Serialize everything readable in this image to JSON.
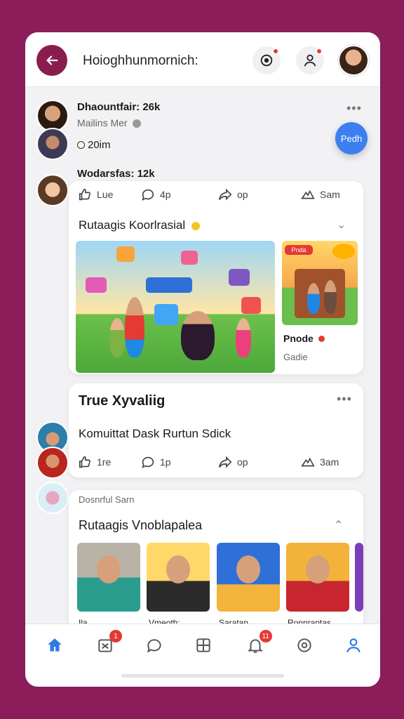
{
  "header": {
    "title": "Hoioghhunmornich:"
  },
  "fab": {
    "label": "Pedh"
  },
  "post1": {
    "author": "Dhaountfair: 26k",
    "sub": "Mailins Mer",
    "stat": "20im",
    "second_line": "Wodarsfas: 12k"
  },
  "card1": {
    "reactions": [
      {
        "icon": "like-icon",
        "label": "Lue"
      },
      {
        "icon": "comment-icon",
        "label": "4p"
      },
      {
        "icon": "share-icon",
        "label": "op"
      },
      {
        "icon": "save-icon",
        "label": "Sam"
      }
    ],
    "title": "Rutaagis Koorlrasial",
    "side_caption": "Pnode",
    "side_sub": "Gadie",
    "side_tag": "Pnda"
  },
  "card2": {
    "heading": "True Xyvaliig",
    "body": "Komuittat Dask Rurtun Sdick",
    "reactions": [
      {
        "icon": "like-icon",
        "label": "1re"
      },
      {
        "icon": "comment-icon",
        "label": "1p"
      },
      {
        "icon": "share-icon",
        "label": "op"
      },
      {
        "icon": "save-icon",
        "label": "3am"
      }
    ]
  },
  "card3": {
    "meta": "Dosnrful Sarn",
    "title": "Rutaagis Vnoblapalea",
    "thumbs": [
      "Ila",
      "Vmeoth:",
      "Saratan",
      "Ronnrantas"
    ]
  },
  "nav": {
    "items": [
      {
        "icon": "home-icon",
        "badge": ""
      },
      {
        "icon": "marketplace-icon",
        "badge": "1"
      },
      {
        "icon": "chat-icon",
        "badge": ""
      },
      {
        "icon": "grid-icon",
        "badge": ""
      },
      {
        "icon": "bell-icon",
        "badge": "11"
      },
      {
        "icon": "at-icon",
        "badge": ""
      },
      {
        "icon": "profile-icon",
        "badge": ""
      }
    ]
  },
  "colors": {
    "brand": "#8a1d4f",
    "accent": "#3d7ff0",
    "badge": "#e53935"
  }
}
